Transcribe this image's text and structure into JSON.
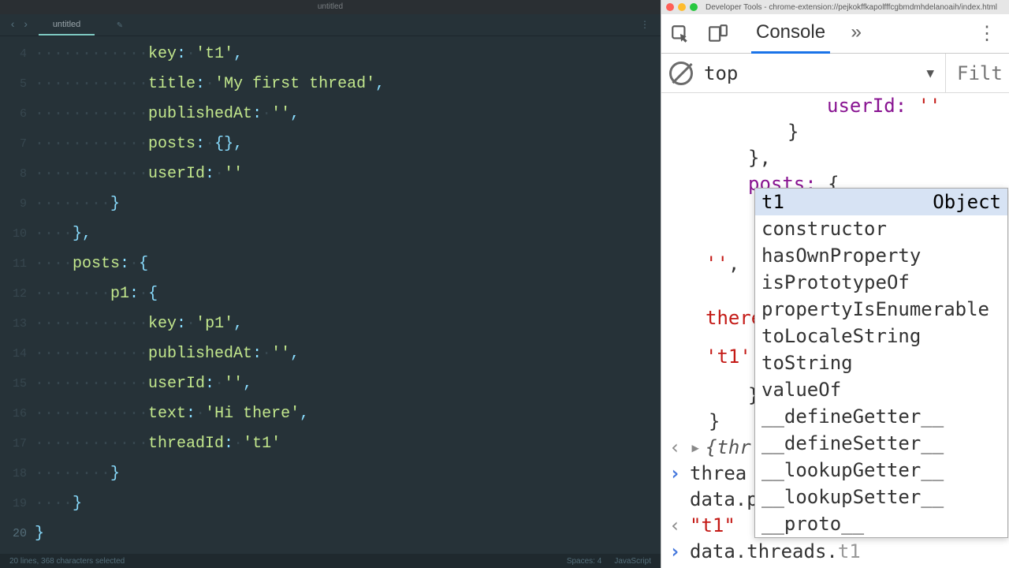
{
  "editor": {
    "window_title": "untitled",
    "tab_label": "untitled",
    "tab_modified_indicator": "✎",
    "line_numbers": [
      "4",
      "5",
      "6",
      "7",
      "8",
      "9",
      "10",
      "11",
      "12",
      "13",
      "14",
      "15",
      "16",
      "17",
      "18",
      "19",
      "20"
    ],
    "active_line": "20",
    "code_lines": [
      {
        "indent": 12,
        "tokens": [
          [
            "key",
            "key"
          ],
          [
            "punc",
            ":"
          ],
          [
            "ws",
            " "
          ],
          [
            "str",
            "'t1'"
          ],
          [
            "punc",
            ","
          ]
        ]
      },
      {
        "indent": 12,
        "tokens": [
          [
            "key",
            "title"
          ],
          [
            "punc",
            ":"
          ],
          [
            "ws",
            " "
          ],
          [
            "str",
            "'My first thread'"
          ],
          [
            "punc",
            ","
          ]
        ]
      },
      {
        "indent": 12,
        "tokens": [
          [
            "key",
            "publishedAt"
          ],
          [
            "punc",
            ":"
          ],
          [
            "ws",
            " "
          ],
          [
            "str",
            "''"
          ],
          [
            "punc",
            ","
          ]
        ]
      },
      {
        "indent": 12,
        "tokens": [
          [
            "key",
            "posts"
          ],
          [
            "punc",
            ":"
          ],
          [
            "ws",
            " "
          ],
          [
            "brace",
            "{}"
          ],
          [
            "punc",
            ","
          ]
        ]
      },
      {
        "indent": 12,
        "tokens": [
          [
            "key",
            "userId"
          ],
          [
            "punc",
            ":"
          ],
          [
            "ws",
            " "
          ],
          [
            "str",
            "''"
          ]
        ]
      },
      {
        "indent": 8,
        "tokens": [
          [
            "brace",
            "}"
          ]
        ]
      },
      {
        "indent": 4,
        "tokens": [
          [
            "brace",
            "}"
          ],
          [
            "punc",
            ","
          ]
        ]
      },
      {
        "indent": 4,
        "tokens": [
          [
            "key",
            "posts"
          ],
          [
            "punc",
            ":"
          ],
          [
            "ws",
            " "
          ],
          [
            "brace",
            "{"
          ]
        ]
      },
      {
        "indent": 8,
        "tokens": [
          [
            "key",
            "p1"
          ],
          [
            "punc",
            ":"
          ],
          [
            "ws",
            " "
          ],
          [
            "brace",
            "{"
          ]
        ]
      },
      {
        "indent": 12,
        "tokens": [
          [
            "key",
            "key"
          ],
          [
            "punc",
            ":"
          ],
          [
            "ws",
            " "
          ],
          [
            "str",
            "'p1'"
          ],
          [
            "punc",
            ","
          ]
        ]
      },
      {
        "indent": 12,
        "tokens": [
          [
            "key",
            "publishedAt"
          ],
          [
            "punc",
            ":"
          ],
          [
            "ws",
            " "
          ],
          [
            "str",
            "''"
          ],
          [
            "punc",
            ","
          ]
        ]
      },
      {
        "indent": 12,
        "tokens": [
          [
            "key",
            "userId"
          ],
          [
            "punc",
            ":"
          ],
          [
            "ws",
            " "
          ],
          [
            "str",
            "''"
          ],
          [
            "punc",
            ","
          ]
        ]
      },
      {
        "indent": 12,
        "tokens": [
          [
            "key",
            "text"
          ],
          [
            "punc",
            ":"
          ],
          [
            "ws",
            " "
          ],
          [
            "str",
            "'Hi there'"
          ],
          [
            "punc",
            ","
          ]
        ]
      },
      {
        "indent": 12,
        "tokens": [
          [
            "key",
            "threadId"
          ],
          [
            "punc",
            ":"
          ],
          [
            "ws",
            " "
          ],
          [
            "str",
            "'t1'"
          ]
        ]
      },
      {
        "indent": 8,
        "tokens": [
          [
            "brace",
            "}"
          ]
        ]
      },
      {
        "indent": 4,
        "tokens": [
          [
            "brace",
            "}"
          ]
        ]
      },
      {
        "indent": 0,
        "tokens": [
          [
            "brace",
            "}"
          ]
        ]
      }
    ],
    "status_left": "20 lines, 368 characters selected",
    "status_spaces": "Spaces: 4",
    "status_lang": "JavaScript"
  },
  "devtools": {
    "title": "Developer Tools - chrome-extension://pejkokffkapolfffcgbmdmhdelanoaih/index.html",
    "tab_console": "Console",
    "context_label": "top",
    "filter_placeholder": "Filter",
    "snippet_userId": "userId: ",
    "snippet_userId_val": "''",
    "snippet_closebrace1": "}",
    "snippet_closebrace2": "},",
    "snippet_posts": "posts: ",
    "snippet_posts_open": "{",
    "snippet_empty_str": "''",
    "snippet_comma": ",",
    "snippet_there": "there",
    "snippet_t1q": "'t1'",
    "snippet_brace_only": "}",
    "snippet_brace_only2": "}",
    "obj_preview": "{thr",
    "line_thread": "threa",
    "line_data_p": "data.p",
    "result_t1": "\"t1\"",
    "input_expr": "data.threads.",
    "input_hint": "t1",
    "autocomplete": {
      "selected": "t1",
      "selected_type": "Object",
      "items": [
        "constructor",
        "hasOwnProperty",
        "isPrototypeOf",
        "propertyIsEnumerable",
        "toLocaleString",
        "toString",
        "valueOf",
        "__defineGetter__",
        "__defineSetter__",
        "__lookupGetter__",
        "__lookupSetter__",
        "__proto__"
      ]
    }
  }
}
